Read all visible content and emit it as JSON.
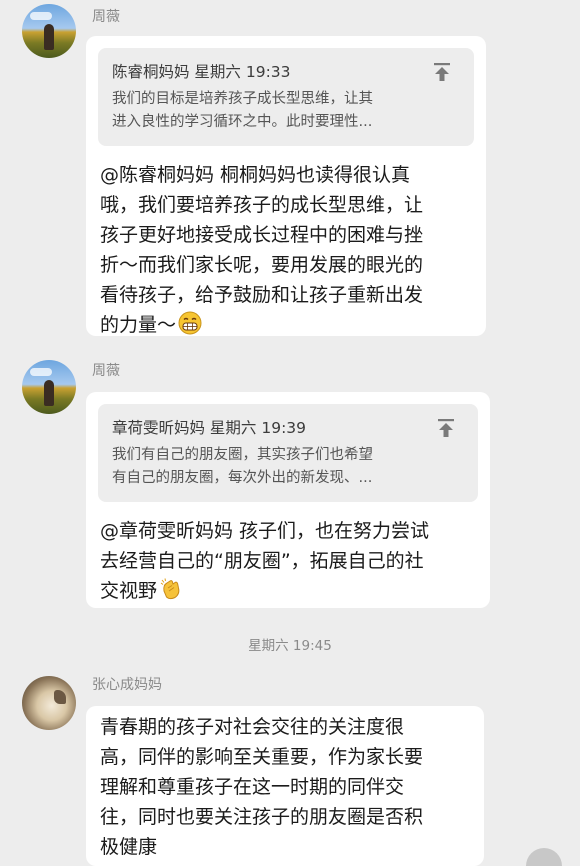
{
  "messages": [
    {
      "sender": "周薇",
      "quote": {
        "header": "陈睿桐妈妈  星期六 19:33",
        "lines": [
          "我们的目标是培养孩子成长型思维，让其",
          "进入良性的学习循环之中。此时要理性..."
        ]
      },
      "lines": [
        "@陈睿桐妈妈 桐桐妈妈也读得很认真",
        "哦，我们要培养孩子的成长型思维，让",
        "孩子更好地接受成长过程中的困难与挫",
        "折～而我们家长呢，要用发展的眼光的",
        "看待孩子，给予鼓励和让孩子重新出发",
        "的力量～"
      ],
      "emoji": "grin-emoji"
    },
    {
      "sender": "周薇",
      "quote": {
        "header": "章荷雯昕妈妈  星期六 19:39",
        "lines": [
          "我们有自己的朋友圈，其实孩子们也希望",
          "有自己的朋友圈，每次外出的新发现、..."
        ]
      },
      "lines": [
        "@章荷雯昕妈妈 孩子们，也在努力尝试",
        "去经营自己的“朋友圈”，拓展自己的社",
        "交视野"
      ],
      "emoji": "clap-emoji"
    }
  ],
  "timestamp": "星期六 19:45",
  "message3": {
    "sender": "张心成妈妈",
    "lines": [
      "青春期的孩子对社会交往的关注度很",
      "高，同伴的影响至关重要，作为家长要",
      "理解和尊重孩子在这一时期的同伴交",
      "往，同时也要关注孩子的朋友圈是否积",
      "极健康"
    ]
  },
  "icons": {
    "pin": "pin-to-top-icon",
    "scroll": "scroll-to-bottom-icon"
  }
}
